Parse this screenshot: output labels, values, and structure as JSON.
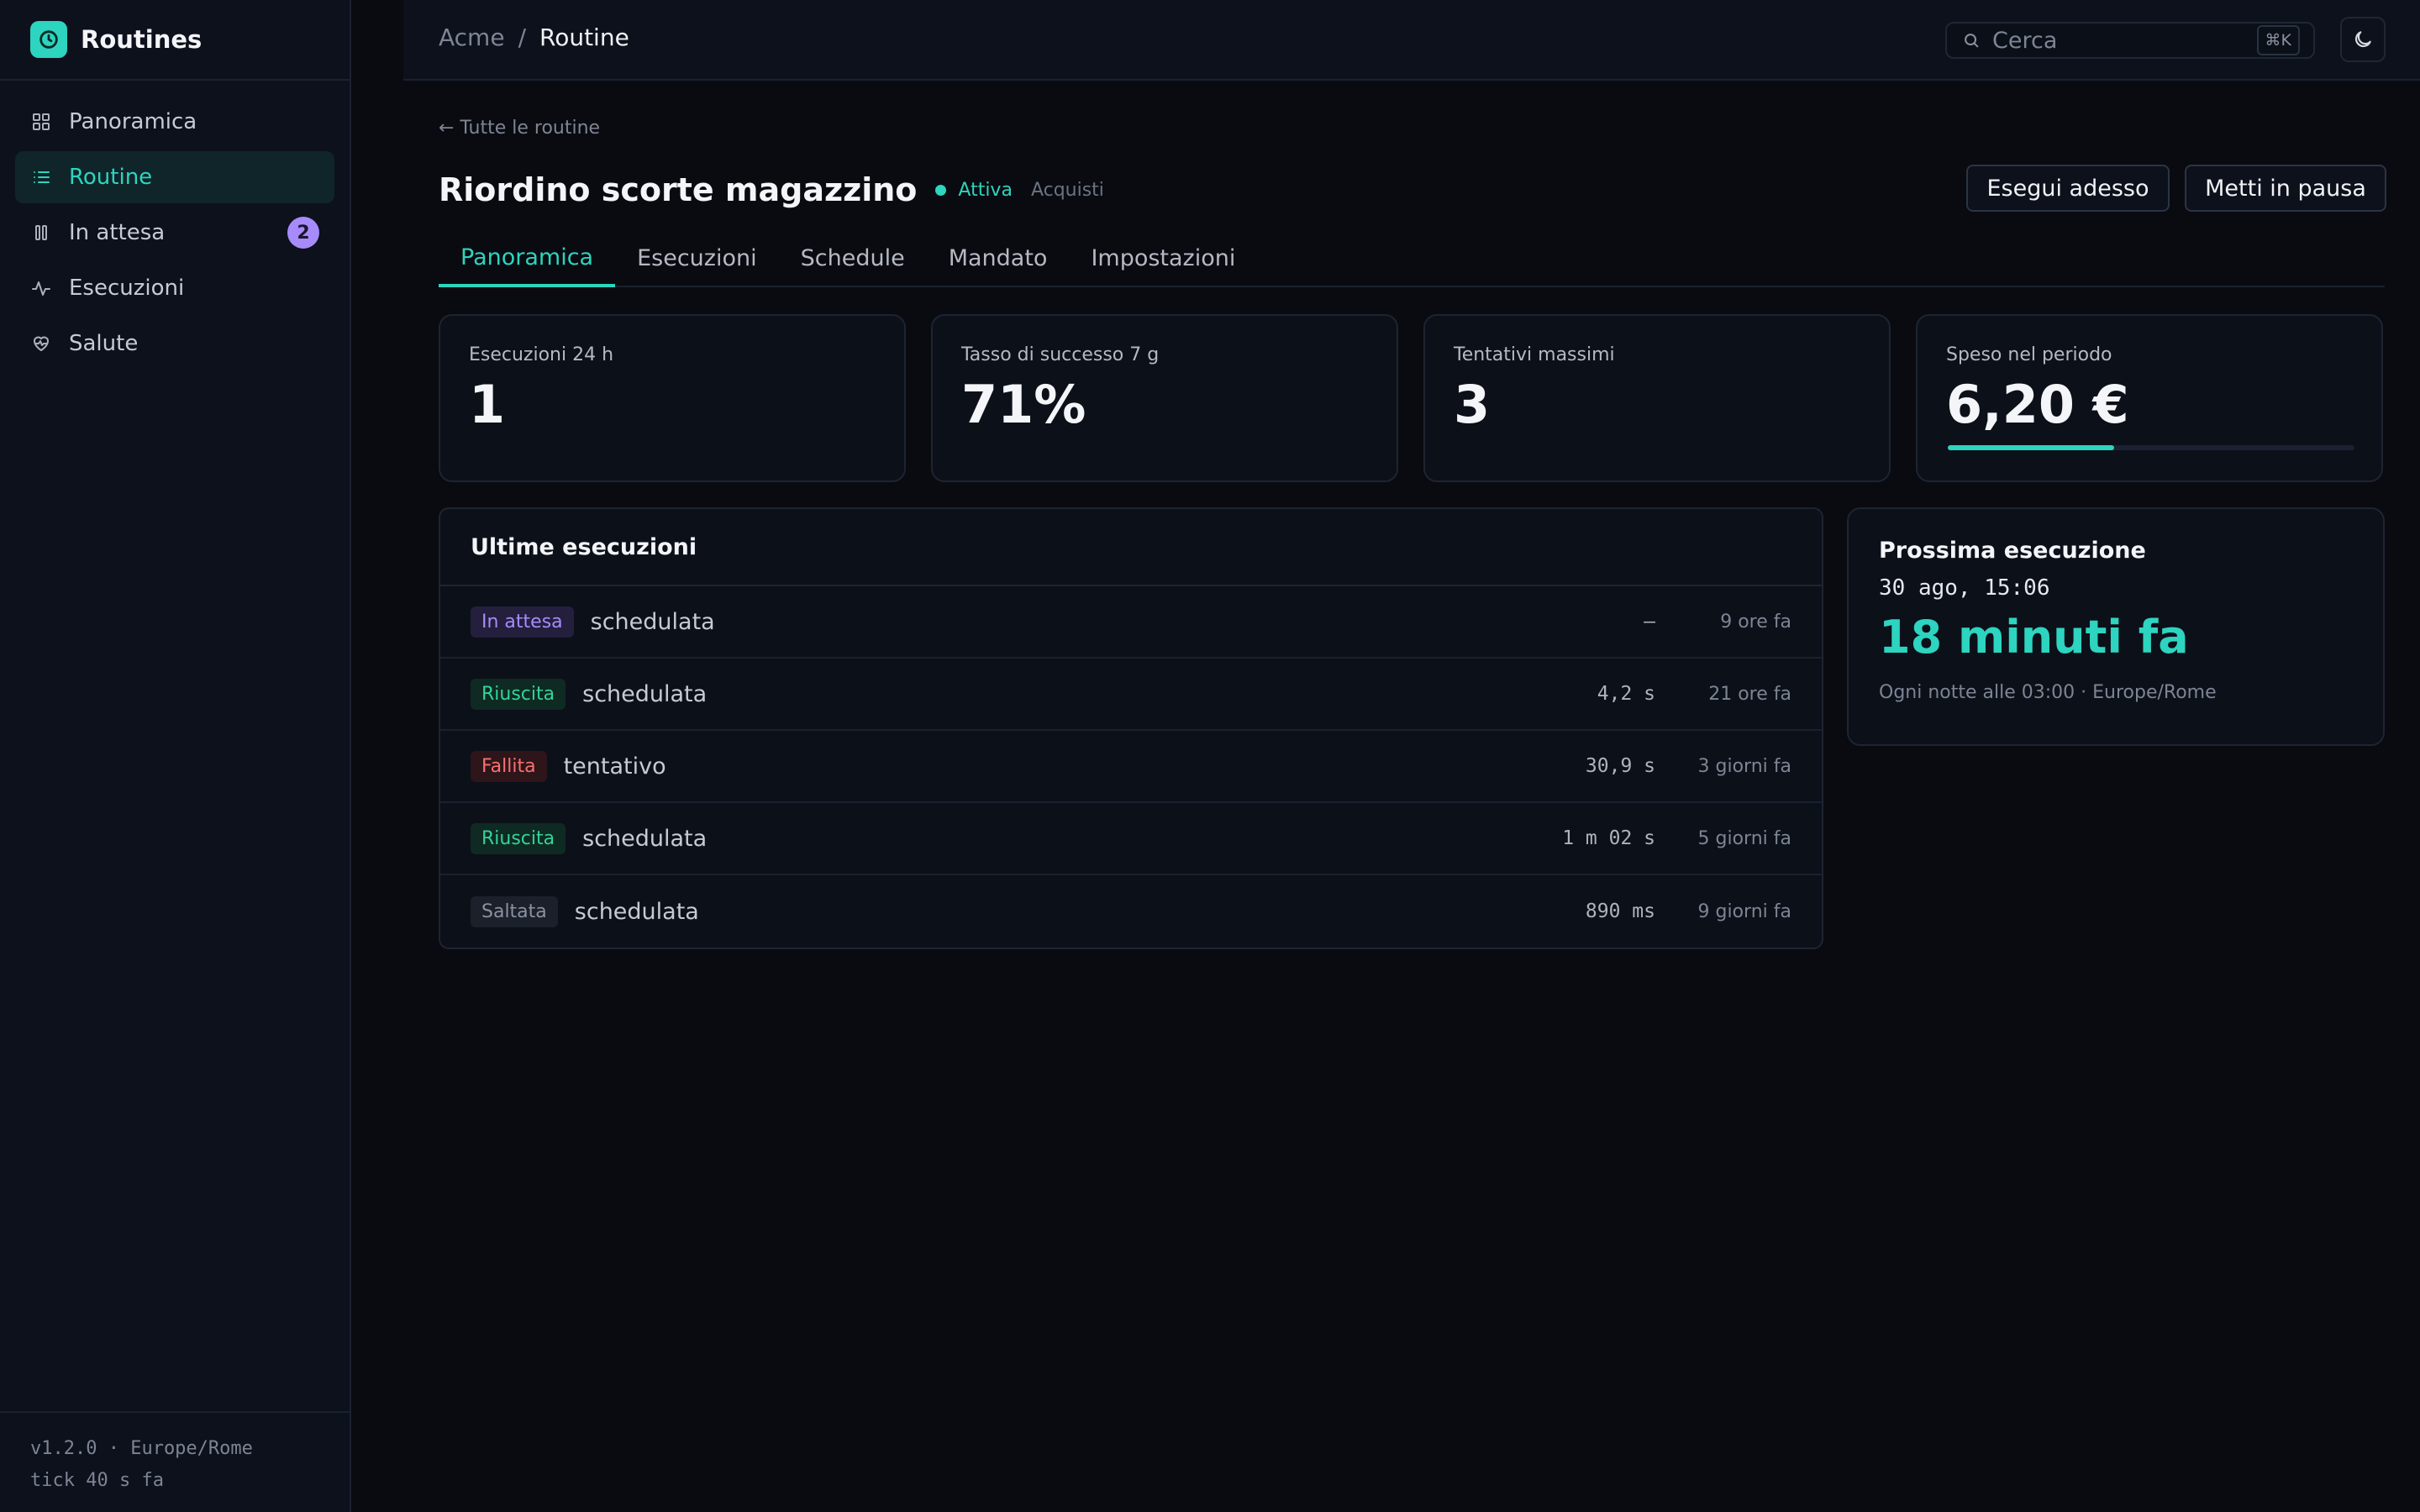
{
  "app": {
    "name": "Routines"
  },
  "sidebar": {
    "items": [
      {
        "label": "Panoramica",
        "icon": "grid-icon"
      },
      {
        "label": "Routine",
        "icon": "list-icon",
        "active": true
      },
      {
        "label": "In attesa",
        "icon": "pause-icon",
        "badge": "2"
      },
      {
        "label": "Esecuzioni",
        "icon": "activity-icon"
      },
      {
        "label": "Salute",
        "icon": "heart-pulse-icon"
      }
    ],
    "footer": {
      "line1": "v1.2.0 · Europe/Rome",
      "line2": "tick 40 s fa"
    }
  },
  "topbar": {
    "breadcrumb": {
      "root": "Acme",
      "sep": "/",
      "current": "Routine"
    },
    "search": {
      "placeholder": "Cerca",
      "shortcut": "⌘K"
    }
  },
  "page": {
    "back_link": "← Tutte le routine",
    "title": "Riordino scorte magazzino",
    "status": "Attiva",
    "category": "Acquisti",
    "buttons": {
      "run": "Esegui adesso",
      "pause": "Metti in pausa"
    },
    "tabs": [
      "Panoramica",
      "Esecuzioni",
      "Schedule",
      "Mandato",
      "Impostazioni"
    ],
    "active_tab": "Panoramica"
  },
  "stats": [
    {
      "label": "Esecuzioni 24 h",
      "value": "1"
    },
    {
      "label": "Tasso di successo 7 g",
      "value": "71%"
    },
    {
      "label": "Tentativi massimi",
      "value": "3"
    },
    {
      "label": "Speso nel periodo",
      "value": "6,20 €",
      "progress": 0.41
    }
  ],
  "recent_runs": {
    "title": "Ultime esecuzioni",
    "rows": [
      {
        "status": "In attesa",
        "status_color": "#a78bfa",
        "status_bg": "#231f3d",
        "trigger": "schedulata",
        "duration": "–",
        "ago": "9 ore fa"
      },
      {
        "status": "Riuscita",
        "status_color": "#34d399",
        "status_bg": "#0f2a22",
        "trigger": "schedulata",
        "duration": "4,2 s",
        "ago": "21 ore fa"
      },
      {
        "status": "Fallita",
        "status_color": "#f87171",
        "status_bg": "#2d151a",
        "trigger": "tentativo",
        "duration": "30,9 s",
        "ago": "3 giorni fa"
      },
      {
        "status": "Riuscita",
        "status_color": "#34d399",
        "status_bg": "#0f2a22",
        "trigger": "schedulata",
        "duration": "1 m 02 s",
        "ago": "5 giorni fa"
      },
      {
        "status": "Saltata",
        "status_color": "#8a91a0",
        "status_bg": "#1b202a",
        "trigger": "schedulata",
        "duration": "890 ms",
        "ago": "9 giorni fa"
      }
    ]
  },
  "next_run": {
    "title": "Prossima esecuzione",
    "when": "30 ago, 15:06",
    "relative": "18 minuti fa",
    "schedule": "Ogni notte alle 03:00 · Europe/Rome"
  },
  "colors": {
    "accent": "#2dd4bf",
    "badge": "#a78bfa"
  }
}
